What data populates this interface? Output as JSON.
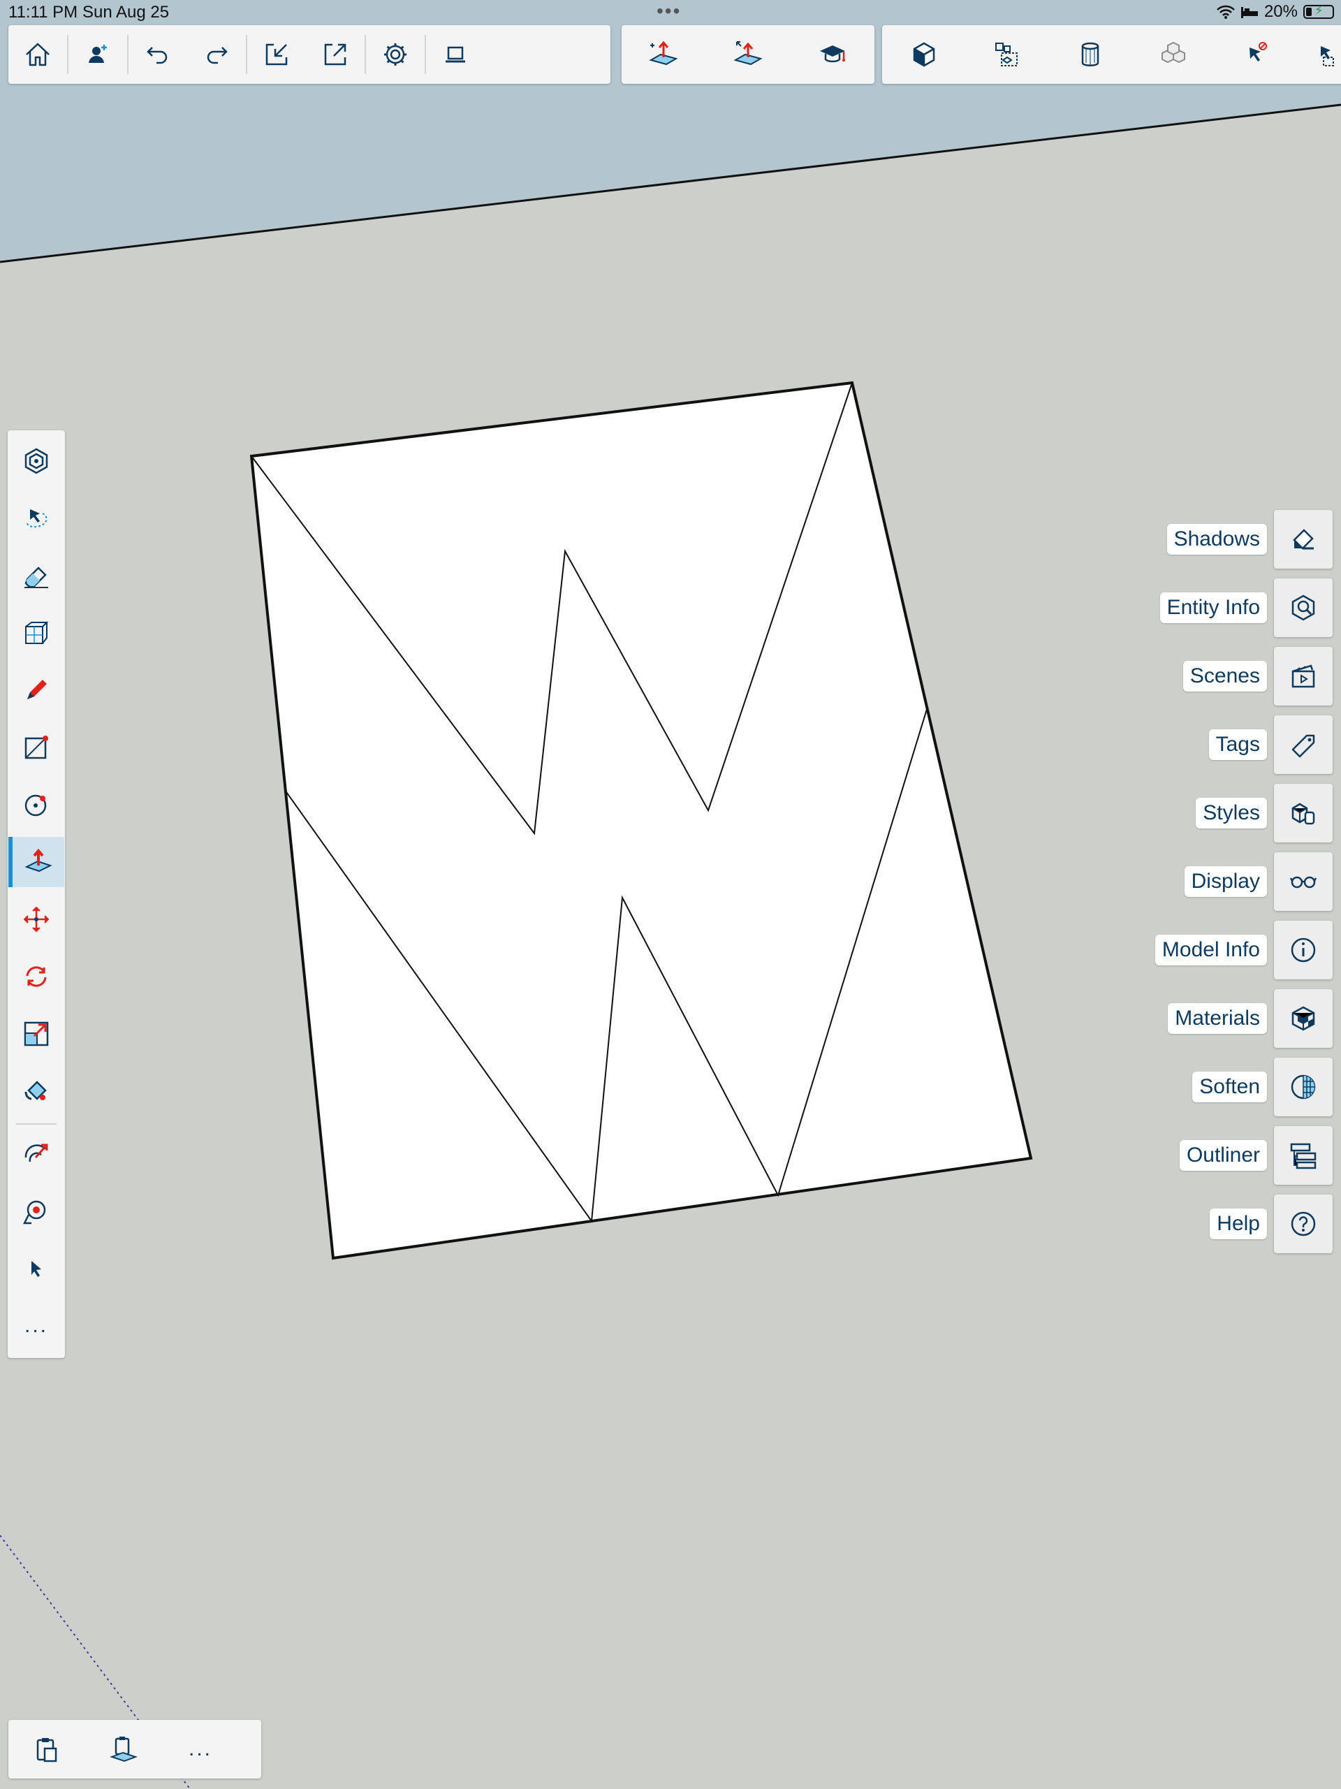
{
  "status_bar": {
    "time": "11:11 PM",
    "date": "Sun Aug 25",
    "battery": "20%",
    "icons": [
      "wifi-icon",
      "sleep-icon",
      "battery-charging-icon"
    ]
  },
  "toolbar": {
    "icons": [
      "home-icon",
      "add-user-icon",
      "undo-icon",
      "redo-icon",
      "import-icon",
      "export-icon",
      "settings-icon",
      "laptop-icon",
      "push-pull-icon",
      "move-face-icon",
      "instructor-icon",
      "solid-inspector-icon",
      "component-icon",
      "cylinder-icon",
      "cubes-icon",
      "select-filter-icon"
    ]
  },
  "sidebar": {
    "tools": [
      "orbit-tool-icon",
      "lasso-select-icon",
      "eraser-icon",
      "cube-icon",
      "pencil-icon",
      "rectangle-icon",
      "circle-icon",
      "push-pull-icon",
      "move-icon",
      "rotate-icon",
      "scale-icon",
      "paint-bucket-icon",
      "follow-me-icon",
      "tape-measure-icon",
      "select-arrow-icon",
      "more-icon"
    ],
    "more_label": "..."
  },
  "panels": [
    {
      "label": "Shadows",
      "icon": "shadows-icon"
    },
    {
      "label": "Entity Info",
      "icon": "entity-info-icon"
    },
    {
      "label": "Scenes",
      "icon": "scenes-icon"
    },
    {
      "label": "Tags",
      "icon": "tags-icon"
    },
    {
      "label": "Styles",
      "icon": "styles-icon"
    },
    {
      "label": "Display",
      "icon": "display-icon"
    },
    {
      "label": "Model Info",
      "icon": "model-info-icon"
    },
    {
      "label": "Materials",
      "icon": "materials-icon"
    },
    {
      "label": "Soften",
      "icon": "soften-icon"
    },
    {
      "label": "Outliner",
      "icon": "outliner-icon"
    },
    {
      "label": "Help",
      "icon": "help-icon"
    }
  ],
  "bottom_bar": {
    "icons": [
      "clipboard-icon",
      "paste-in-place-icon",
      "more-icon"
    ],
    "more_label": "..."
  },
  "colors": {
    "sky": "#b3c5cf",
    "ground": "#cdcfca",
    "accent": "#1a8fd1",
    "icon_blue": "#0d3a5e",
    "icon_red": "#e0221b"
  }
}
